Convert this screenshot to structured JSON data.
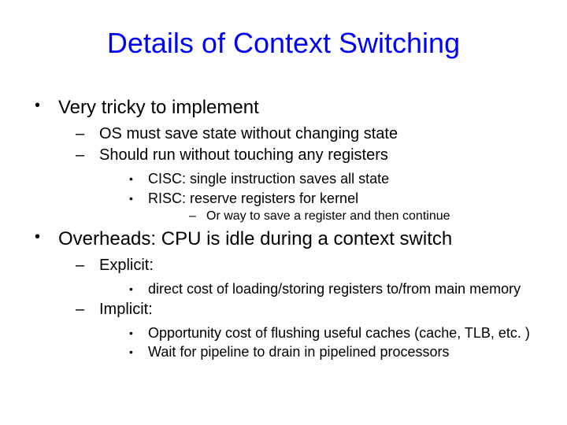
{
  "title": "Details of Context Switching",
  "b1": "Very tricky to implement",
  "b1_1": "OS must save state without changing state",
  "b1_2": "Should run without touching any registers",
  "b1_2_1": "CISC: single instruction saves all state",
  "b1_2_2": "RISC: reserve registers for kernel",
  "b1_2_2_1": "Or way to save a register and then continue",
  "b2": "Overheads: CPU is idle during a context switch",
  "b2_1": "Explicit:",
  "b2_1_1": "direct cost of loading/storing registers to/from main memory",
  "b2_2": "Implicit:",
  "b2_2_1": "Opportunity cost of flushing useful caches (cache, TLB, etc. )",
  "b2_2_2": "Wait for pipeline to drain in pipelined processors"
}
